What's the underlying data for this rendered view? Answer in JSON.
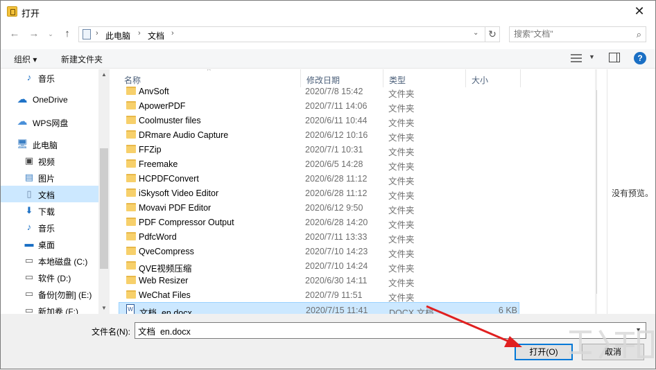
{
  "window": {
    "title": "打开",
    "close_label": "✕"
  },
  "address": {
    "crumbs": [
      "此电脑",
      "文档"
    ]
  },
  "search": {
    "placeholder": "搜索\"文档\""
  },
  "toolbar": {
    "organize_label": "组织 ▾",
    "new_folder_label": "新建文件夹",
    "help_label": "?"
  },
  "sidebar": {
    "items": [
      {
        "label": "音乐",
        "icon": "music-icon"
      },
      {
        "label": "OneDrive",
        "icon": "cloud-icon"
      },
      {
        "label": "WPS网盘",
        "icon": "wps-cloud-icon"
      },
      {
        "label": "此电脑",
        "icon": "computer-icon"
      },
      {
        "label": "视频",
        "icon": "video-icon"
      },
      {
        "label": "图片",
        "icon": "picture-icon"
      },
      {
        "label": "文档",
        "icon": "document-icon",
        "selected": true
      },
      {
        "label": "下载",
        "icon": "download-icon"
      },
      {
        "label": "音乐",
        "icon": "music-icon"
      },
      {
        "label": "桌面",
        "icon": "desktop-icon"
      },
      {
        "label": "本地磁盘 (C:)",
        "icon": "drive-icon"
      },
      {
        "label": "软件 (D:)",
        "icon": "drive-icon"
      },
      {
        "label": "备份[勿删] (E:)",
        "icon": "drive-icon"
      },
      {
        "label": "新加卷 (F:)",
        "icon": "drive-icon"
      }
    ]
  },
  "columns": {
    "name": "名称",
    "date": "修改日期",
    "type": "类型",
    "size": "大小"
  },
  "files": [
    {
      "name": "AnvSoft",
      "date": "2020/7/8 15:42",
      "type": "文件夹",
      "size": "",
      "kind": "folder"
    },
    {
      "name": "ApowerPDF",
      "date": "2020/7/11 14:06",
      "type": "文件夹",
      "size": "",
      "kind": "folder"
    },
    {
      "name": "Coolmuster files",
      "date": "2020/6/11 10:44",
      "type": "文件夹",
      "size": "",
      "kind": "folder"
    },
    {
      "name": "DRmare Audio Capture",
      "date": "2020/6/12 10:16",
      "type": "文件夹",
      "size": "",
      "kind": "folder"
    },
    {
      "name": "FFZip",
      "date": "2020/7/1 10:31",
      "type": "文件夹",
      "size": "",
      "kind": "folder"
    },
    {
      "name": "Freemake",
      "date": "2020/6/5 14:28",
      "type": "文件夹",
      "size": "",
      "kind": "folder"
    },
    {
      "name": "HCPDFConvert",
      "date": "2020/6/28 11:12",
      "type": "文件夹",
      "size": "",
      "kind": "folder"
    },
    {
      "name": "iSkysoft Video Editor",
      "date": "2020/6/28 11:12",
      "type": "文件夹",
      "size": "",
      "kind": "folder"
    },
    {
      "name": "Movavi PDF Editor",
      "date": "2020/6/12 9:50",
      "type": "文件夹",
      "size": "",
      "kind": "folder"
    },
    {
      "name": "PDF Compressor Output",
      "date": "2020/6/28 14:20",
      "type": "文件夹",
      "size": "",
      "kind": "folder"
    },
    {
      "name": "PdfcWord",
      "date": "2020/7/11 13:33",
      "type": "文件夹",
      "size": "",
      "kind": "folder"
    },
    {
      "name": "QveCompress",
      "date": "2020/7/10 14:23",
      "type": "文件夹",
      "size": "",
      "kind": "folder"
    },
    {
      "name": "QVE视频压缩",
      "date": "2020/7/10 14:24",
      "type": "文件夹",
      "size": "",
      "kind": "folder"
    },
    {
      "name": "Web Resizer",
      "date": "2020/6/30 14:11",
      "type": "文件夹",
      "size": "",
      "kind": "folder"
    },
    {
      "name": "WeChat Files",
      "date": "2020/7/9 11:51",
      "type": "文件夹",
      "size": "",
      "kind": "folder"
    },
    {
      "name": "文档_en.docx",
      "date": "2020/7/15 11:41",
      "type": "DOCX 文档",
      "size": "6 KB",
      "kind": "docx",
      "selected": true
    }
  ],
  "preview": {
    "text": "没有预览。"
  },
  "bottom": {
    "filename_label": "文件名(N):",
    "filename_value": "文档_en.docx",
    "open_label": "打开(O)",
    "cancel_label": "取消"
  },
  "colors": {
    "selection": "#cce8ff",
    "accent": "#0078d7",
    "arrow": "#e02020"
  }
}
